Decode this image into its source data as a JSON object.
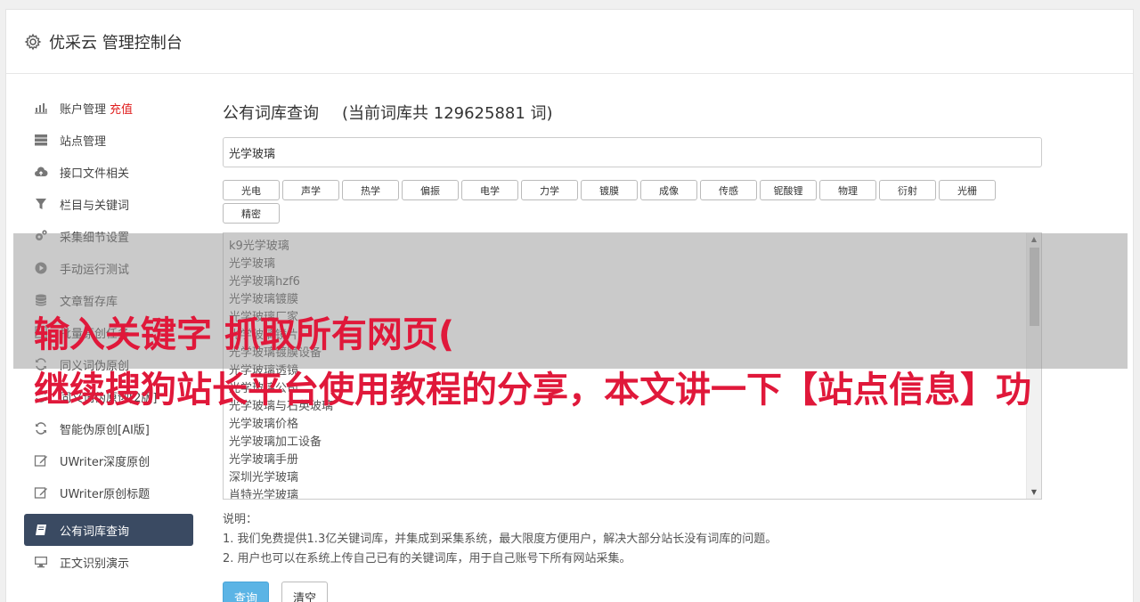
{
  "header": {
    "title": "优采云 管理控制台",
    "icon": "gear-icon"
  },
  "sidebar": {
    "items": [
      {
        "label": "账户管理",
        "extra": "充值",
        "icon": "bar-chart-icon"
      },
      {
        "label": "站点管理",
        "icon": "server-icon"
      },
      {
        "label": "接口文件相关",
        "icon": "cloud-upload-icon"
      },
      {
        "label": "栏目与关键词",
        "icon": "filter-icon"
      },
      {
        "label": "采集细节设置",
        "icon": "cogs-icon"
      },
      {
        "label": "手动运行测试",
        "icon": "play-circle-icon"
      },
      {
        "label": "文章暂存库",
        "icon": "database-icon"
      },
      {
        "label": "批量原创任务",
        "icon": "task-icon"
      },
      {
        "label": "同义词伪原创",
        "icon": "refresh-icon"
      },
      {
        "label": "同义词伪原创[2版]",
        "icon": "refresh-icon"
      },
      {
        "label": "智能伪原创[AI版]",
        "icon": "refresh-icon"
      },
      {
        "label": "UWriter深度原创",
        "icon": "edit-icon"
      },
      {
        "label": "UWriter原创标题",
        "icon": "edit-icon"
      },
      {
        "label": "公有词库查询",
        "icon": "book-icon",
        "active": true
      },
      {
        "label": "正文识别演示",
        "icon": "desktop-icon"
      }
    ]
  },
  "main": {
    "title": "公有词库查询",
    "count_text": "(当前词库共 129625881 词)",
    "keyword_value": "光学玻璃",
    "tags": [
      "光电",
      "声学",
      "热学",
      "偏振",
      "电学",
      "力学",
      "镀膜",
      "成像",
      "传感",
      "铌酸锂",
      "物理",
      "衍射",
      "光栅",
      "精密"
    ],
    "results": [
      "k9光学玻璃",
      "光学玻璃",
      "光学玻璃hzf6",
      "光学玻璃镀膜",
      "光学玻璃厂家",
      "光学玻璃镜片",
      "光学玻璃镀膜设备",
      "光学玻璃透镜",
      "光学玻璃公司",
      "光学玻璃与石英玻璃",
      "光学玻璃价格",
      "光学玻璃加工设备",
      "光学玻璃手册",
      "深圳光学玻璃",
      "肖特光学玻璃"
    ],
    "notes": [
      "说明：",
      "1. 我们免费提供1.3亿关键词库，并集成到采集系统，最大限度方便用户，解决大部分站长没有词库的问题。",
      "2. 用户也可以在系统上传自己已有的关键词库，用于自己账号下所有网站采集。"
    ],
    "query_button": "查询",
    "clear_button": "清空"
  },
  "overlay": {
    "line1": "输入关键字 抓取所有网页(",
    "line2": "继续搜狗站长平台使用教程的分享，本文讲一下【站点信息】功"
  },
  "colors": {
    "accent": "#5bb4e5",
    "active_nav": "#3a4a62",
    "overlay_text": "#e0183a",
    "recharge": "#e02020"
  }
}
